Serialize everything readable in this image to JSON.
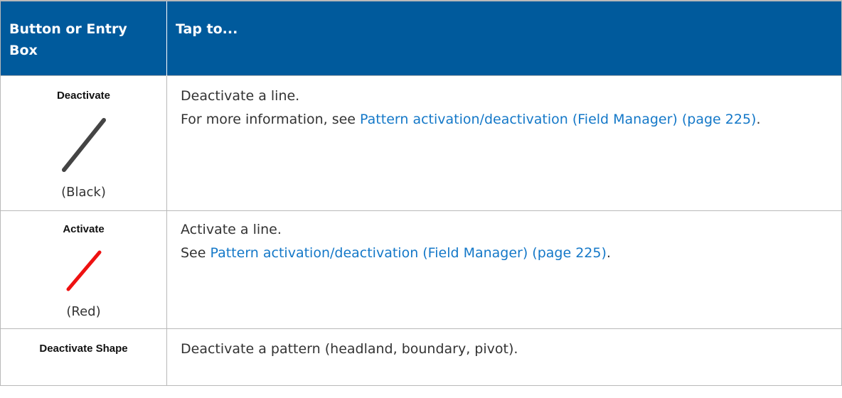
{
  "table": {
    "headers": [
      "Button or Entry Box",
      "Tap to..."
    ],
    "rows": [
      {
        "button_label": "Deactivate",
        "icon": "black-line-icon",
        "icon_color": "#444444",
        "colour_note": "(Black)",
        "description": "Deactivate a line.",
        "more_info_prefix": "For more information, see ",
        "link_text": "Pattern activation/deactivation (Field Manager) (page 225)",
        "more_info_suffix": "."
      },
      {
        "button_label": "Activate",
        "icon": "red-line-icon",
        "icon_color": "#ee1111",
        "colour_note": "(Red)",
        "description": "Activate a line.",
        "more_info_prefix": "See ",
        "link_text": "Pattern activation/deactivation (Field Manager) (page 225)",
        "more_info_suffix": "."
      },
      {
        "button_label": "Deactivate Shape",
        "description": "Deactivate a pattern (headland, boundary, pivot)."
      }
    ]
  },
  "colors": {
    "header_bg": "#005a9c",
    "link": "#1478c8",
    "border": "#b9b9b9"
  }
}
